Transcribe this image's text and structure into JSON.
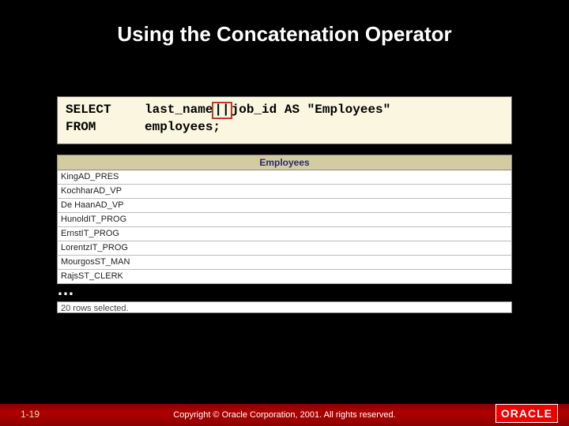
{
  "title": "Using the Concatenation Operator",
  "code": {
    "kw1": "SELECT",
    "expr_left": "last_name",
    "expr_hl": "||",
    "expr_right": "job_id AS \"Employees\"",
    "kw2": "FROM",
    "from_clause": "employees;"
  },
  "result": {
    "header": "Employees",
    "rows": [
      "KingAD_PRES",
      "KochharAD_VP",
      "De HaanAD_VP",
      "HunoldIT_PROG",
      "ErnstIT_PROG",
      "LorentzIT_PROG",
      "MourgosST_MAN",
      "RajsST_CLERK"
    ],
    "summary": "20 rows selected."
  },
  "ellipsis": "…",
  "footer": {
    "page": "1-19",
    "copyright": "Copyright © Oracle Corporation, 2001. All rights reserved.",
    "logo": "ORACLE"
  }
}
